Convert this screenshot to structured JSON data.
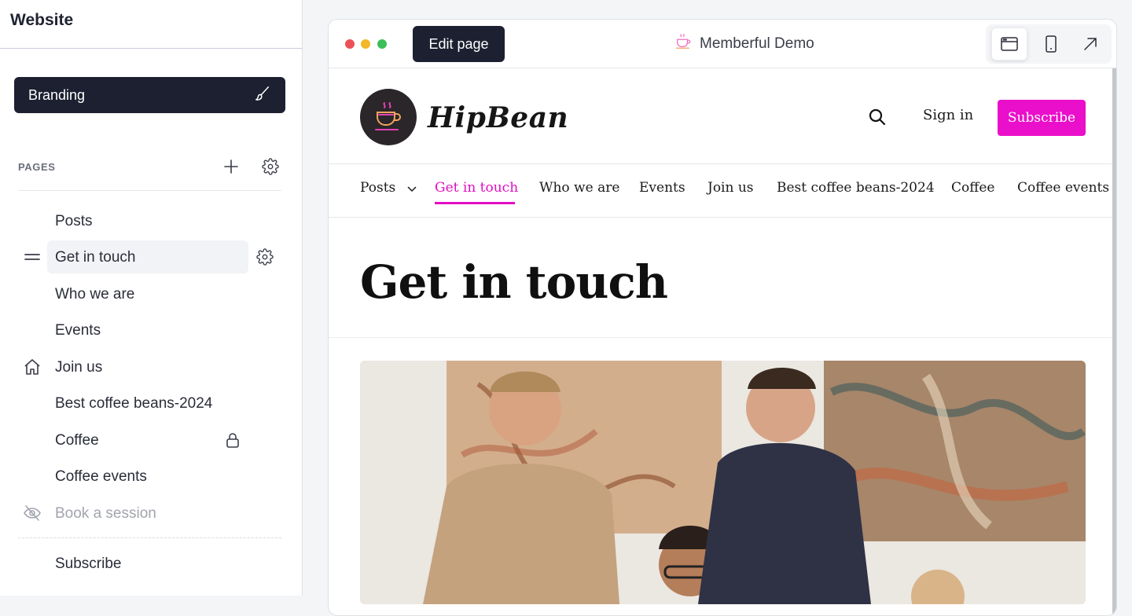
{
  "sidebar": {
    "title": "Website",
    "branding_label": "Branding",
    "pages_label": "PAGES",
    "pages": [
      {
        "label": "Posts",
        "state": "normal"
      },
      {
        "label": "Get in touch",
        "state": "active"
      },
      {
        "label": "Who we are",
        "state": "normal"
      },
      {
        "label": "Events",
        "state": "normal"
      },
      {
        "label": "Join us",
        "state": "home"
      },
      {
        "label": "Best coffee beans-2024",
        "state": "normal"
      },
      {
        "label": "Coffee",
        "state": "locked"
      },
      {
        "label": "Coffee events",
        "state": "normal"
      },
      {
        "label": "Book a session",
        "state": "hidden"
      }
    ],
    "footer_pages": [
      {
        "label": "Subscribe"
      }
    ]
  },
  "preview": {
    "edit_label": "Edit page",
    "site_name": "Memberful Demo",
    "traffic_lights": [
      "#ed4f56",
      "#f3b728",
      "#3cbf5a"
    ]
  },
  "site": {
    "logo_text": "HipBean",
    "sign_in": "Sign in",
    "subscribe": "Subscribe",
    "accent": "#ea0fca",
    "nav": [
      "Posts",
      "Get in touch",
      "Who we are",
      "Events",
      "Join us",
      "Best coffee beans-2024",
      "Coffee",
      "Coffee events"
    ],
    "nav_active": "Get in touch",
    "page_title": "Get in touch"
  },
  "icons": {
    "branding": "brush-icon",
    "add_page": "plus-icon",
    "pages_settings": "gear-icon",
    "drag": "drag-handle-icon",
    "home": "home-icon",
    "lock": "lock-icon",
    "hidden": "eye-off-icon",
    "desktop_view": "browser-window-icon",
    "mobile_view": "mobile-icon",
    "open_external": "arrow-up-right-icon",
    "search": "search-icon"
  }
}
